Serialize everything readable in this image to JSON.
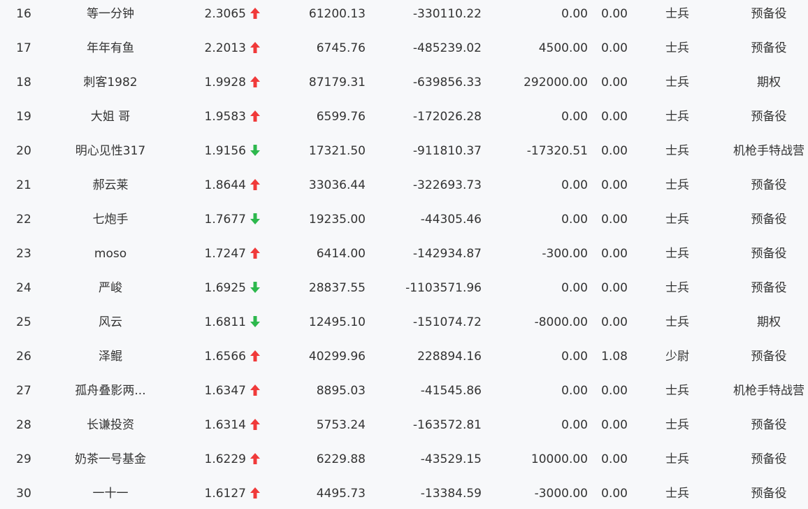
{
  "colors": {
    "up": "#f03a3a",
    "down": "#2db84d",
    "text": "#333333",
    "background": "#f7f8fa"
  },
  "rows": [
    {
      "rank": "16",
      "name": "等一分钟",
      "ratio": "2.3065",
      "trend": "up",
      "a": "61200.13",
      "b": "-330110.22",
      "c": "0.00",
      "d": "0.00",
      "level": "士兵",
      "type": "预备役"
    },
    {
      "rank": "17",
      "name": "年年有鱼",
      "ratio": "2.2013",
      "trend": "up",
      "a": "6745.76",
      "b": "-485239.02",
      "c": "4500.00",
      "d": "0.00",
      "level": "士兵",
      "type": "预备役"
    },
    {
      "rank": "18",
      "name": "刺客1982",
      "ratio": "1.9928",
      "trend": "up",
      "a": "87179.31",
      "b": "-639856.33",
      "c": "292000.00",
      "d": "0.00",
      "level": "士兵",
      "type": "期权"
    },
    {
      "rank": "19",
      "name": "大姐 哥",
      "ratio": "1.9583",
      "trend": "up",
      "a": "6599.76",
      "b": "-172026.28",
      "c": "0.00",
      "d": "0.00",
      "level": "士兵",
      "type": "预备役"
    },
    {
      "rank": "20",
      "name": "明心见性317",
      "ratio": "1.9156",
      "trend": "down",
      "a": "17321.50",
      "b": "-911810.37",
      "c": "-17320.51",
      "d": "0.00",
      "level": "士兵",
      "type": "机枪手特战营"
    },
    {
      "rank": "21",
      "name": "郝云莱",
      "ratio": "1.8644",
      "trend": "up",
      "a": "33036.44",
      "b": "-322693.73",
      "c": "0.00",
      "d": "0.00",
      "level": "士兵",
      "type": "预备役"
    },
    {
      "rank": "22",
      "name": "七炮手",
      "ratio": "1.7677",
      "trend": "down",
      "a": "19235.00",
      "b": "-44305.46",
      "c": "0.00",
      "d": "0.00",
      "level": "士兵",
      "type": "预备役"
    },
    {
      "rank": "23",
      "name": "moso",
      "ratio": "1.7247",
      "trend": "up",
      "a": "6414.00",
      "b": "-142934.87",
      "c": "-300.00",
      "d": "0.00",
      "level": "士兵",
      "type": "预备役"
    },
    {
      "rank": "24",
      "name": "严峻",
      "ratio": "1.6925",
      "trend": "down",
      "a": "28837.55",
      "b": "-1103571.96",
      "c": "0.00",
      "d": "0.00",
      "level": "士兵",
      "type": "预备役"
    },
    {
      "rank": "25",
      "name": "风云",
      "ratio": "1.6811",
      "trend": "down",
      "a": "12495.10",
      "b": "-151074.72",
      "c": "-8000.00",
      "d": "0.00",
      "level": "士兵",
      "type": "期权"
    },
    {
      "rank": "26",
      "name": "泽鲲",
      "ratio": "1.6566",
      "trend": "up",
      "a": "40299.96",
      "b": "228894.16",
      "c": "0.00",
      "d": "1.08",
      "level": "少尉",
      "type": "预备役"
    },
    {
      "rank": "27",
      "name": "孤舟叠影两...",
      "ratio": "1.6347",
      "trend": "up",
      "a": "8895.03",
      "b": "-41545.86",
      "c": "0.00",
      "d": "0.00",
      "level": "士兵",
      "type": "机枪手特战营"
    },
    {
      "rank": "28",
      "name": "长谦投资",
      "ratio": "1.6314",
      "trend": "up",
      "a": "5753.24",
      "b": "-163572.81",
      "c": "0.00",
      "d": "0.00",
      "level": "士兵",
      "type": "预备役"
    },
    {
      "rank": "29",
      "name": "奶茶一号基金",
      "ratio": "1.6229",
      "trend": "up",
      "a": "6229.88",
      "b": "-43529.15",
      "c": "10000.00",
      "d": "0.00",
      "level": "士兵",
      "type": "预备役"
    },
    {
      "rank": "30",
      "name": "一十一",
      "ratio": "1.6127",
      "trend": "up",
      "a": "4495.73",
      "b": "-13384.59",
      "c": "-3000.00",
      "d": "0.00",
      "level": "士兵",
      "type": "预备役"
    }
  ]
}
